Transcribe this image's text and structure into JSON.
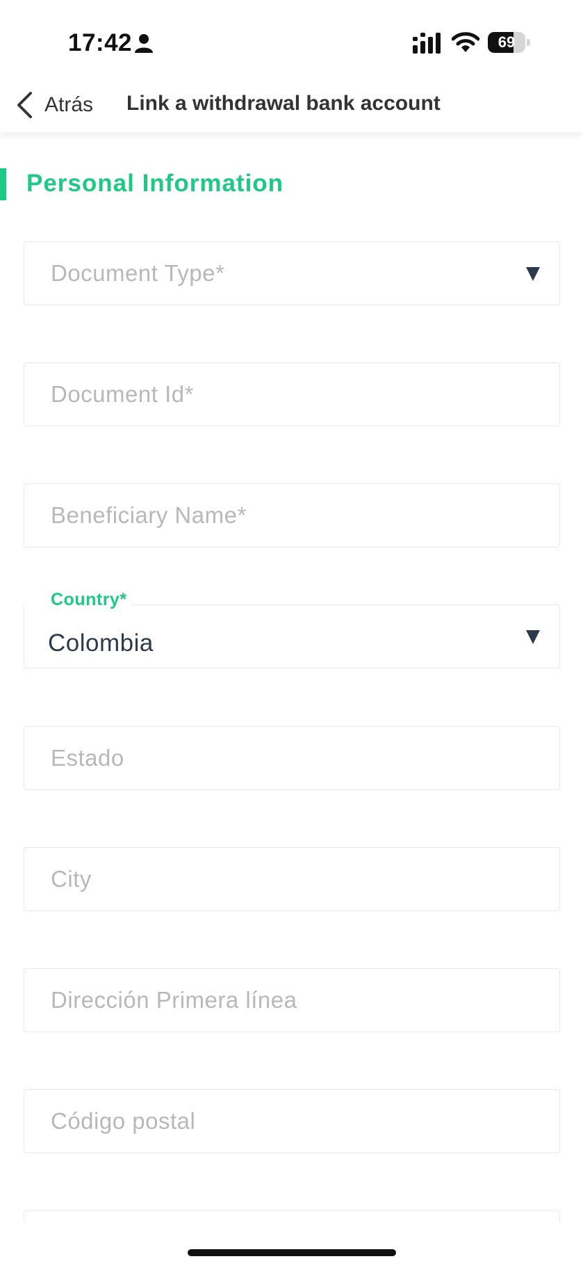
{
  "status_bar": {
    "time": "17:42",
    "battery": "69",
    "battery_level": 0.69,
    "icons": [
      "person-icon",
      "signal-icon",
      "wifi-icon",
      "battery-icon"
    ]
  },
  "nav": {
    "back_label": "Atrás",
    "back_icon": "chevron-left-icon",
    "title": "Link a withdrawal bank account"
  },
  "section": {
    "title": "Personal Information"
  },
  "form": {
    "document_type": {
      "placeholder": "Document Type*"
    },
    "document_id": {
      "placeholder": "Document Id*"
    },
    "beneficiary_name": {
      "placeholder": "Beneficiary Name*"
    },
    "country": {
      "label": "Country*",
      "value": "Colombia"
    },
    "estado": {
      "placeholder": "Estado"
    },
    "city": {
      "placeholder": "City"
    },
    "address_line1": {
      "placeholder": "Dirección Primera línea"
    },
    "postal_code": {
      "placeholder": "Código postal"
    }
  },
  "colors": {
    "accent": "#1ec986",
    "text_dark": "#2c3a4e",
    "placeholder": "#b8b8b8"
  }
}
